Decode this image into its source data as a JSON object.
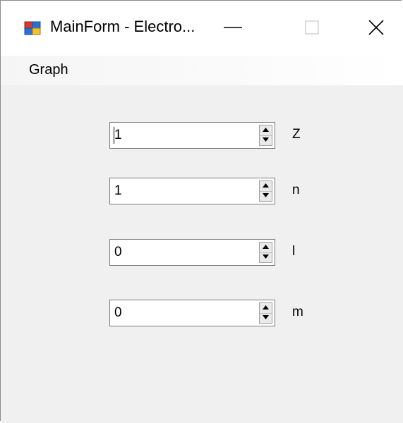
{
  "window": {
    "title": "MainForm - Electro...",
    "controls": {
      "minimize": "minimize",
      "maximize": "maximize",
      "close": "close"
    }
  },
  "menu": {
    "items": [
      {
        "label": "Graph"
      }
    ]
  },
  "fields": [
    {
      "value": "1",
      "label": "Z",
      "has_caret": true
    },
    {
      "value": "1",
      "label": "n"
    },
    {
      "value": "0",
      "label": "l"
    },
    {
      "value": "0",
      "label": "m"
    }
  ],
  "icons": {
    "app": "app-window-icon",
    "minimize": "minimize-icon",
    "maximize": "maximize-icon",
    "close": "close-icon",
    "spin_up": "spin-up-arrow-icon",
    "spin_down": "spin-down-arrow-icon"
  },
  "colors": {
    "titlebar_bg": "#ffffff",
    "client_bg": "#f0f0f0",
    "input_border": "#7a7a7a",
    "app_icon_red": "#d83b2a",
    "app_icon_blue": "#2a6fd8",
    "app_icon_yellow": "#f2c12e"
  }
}
